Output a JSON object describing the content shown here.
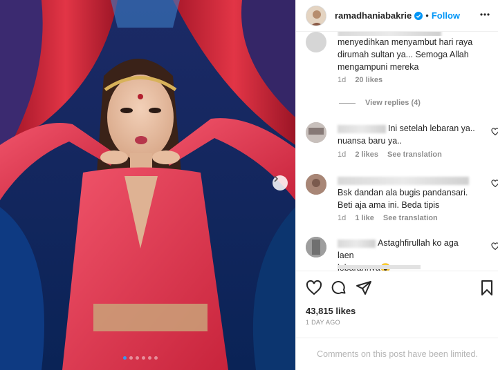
{
  "post": {
    "username": "ramadhaniabakrie",
    "separator": "•",
    "follow_label": "Follow",
    "likes_text": "43,815 likes",
    "date_text": "1 DAY AGO",
    "comments_limited_text": "Comments on this post have been limited.",
    "carousel_count": 6,
    "carousel_active": 0
  },
  "comments": [
    {
      "text_line1": "menyedihkan menyambut hari raya",
      "text_line2": "dirumah sultan ya... Semoga Allah",
      "text_line3": "mengampuni mereka",
      "age": "1d",
      "likes": "20 likes",
      "view_replies": "View replies (4)"
    },
    {
      "text_line1": "Ini setelah lebaran ya..",
      "text_line2": "nuansa baru ya..",
      "age": "1d",
      "likes": "2 likes",
      "see_translation": "See translation"
    },
    {
      "text_line1": "Bsk dandan ala bugis pandansari.",
      "text_line2": "Beti aja ama ini. Beda tipis",
      "age": "1d",
      "likes": "1 like",
      "see_translation": "See translation"
    },
    {
      "text_line1": "Astaghfirullah ko aga laen",
      "text_line2": "lebarannya",
      "emoji": "😮"
    }
  ],
  "colors": {
    "accent": "#0095f6",
    "carousel_active_dot": "#3897f0",
    "dress": "#e8394f",
    "curtain_red": "#d42b3a",
    "curtain_purple": "#3a2a6e",
    "background_blue": "#12306a"
  },
  "icons": [
    "verified-badge-icon",
    "more-options-icon",
    "chevron-right-icon",
    "heart-icon",
    "comment-icon",
    "share-icon",
    "bookmark-icon"
  ]
}
